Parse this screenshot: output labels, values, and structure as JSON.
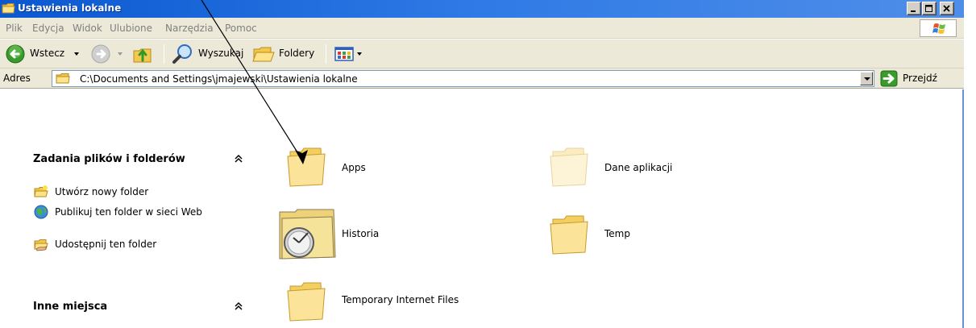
{
  "window": {
    "title": "Ustawienia lokalne"
  },
  "menu": {
    "items": [
      "Plik",
      "Edycja",
      "Widok",
      "Ulubione",
      "Narzędzia",
      "Pomoc"
    ]
  },
  "toolbar": {
    "back_label": "Wstecz",
    "search_label": "Wyszukaj",
    "folders_label": "Foldery"
  },
  "address": {
    "label": "Adres",
    "path": "C:\\Documents and Settings\\jmajewski\\Ustawienia lokalne",
    "go_label": "Przejdź"
  },
  "sidebar": {
    "file_tasks": {
      "title": "Zadania plików i folderów",
      "items": [
        {
          "label": "Utwórz nowy folder",
          "icon": "new-folder-icon"
        },
        {
          "label": "Publikuj ten folder w sieci Web",
          "icon": "publish-web-icon"
        },
        {
          "label": "Udostępnij ten folder",
          "icon": "share-folder-icon"
        }
      ]
    },
    "other_places": {
      "title": "Inne miejsca"
    }
  },
  "folders": [
    {
      "name": "Apps",
      "icon": "folder-icon"
    },
    {
      "name": "Dane aplikacji",
      "icon": "hidden-folder-icon"
    },
    {
      "name": "Historia",
      "icon": "history-folder-icon"
    },
    {
      "name": "Temp",
      "icon": "folder-icon"
    },
    {
      "name": "Temporary Internet Files",
      "icon": "folder-icon"
    }
  ],
  "colors": {
    "titlebar": "#0a58d0",
    "chrome": "#ece9d8",
    "folder_yellow": "#f5d878"
  }
}
